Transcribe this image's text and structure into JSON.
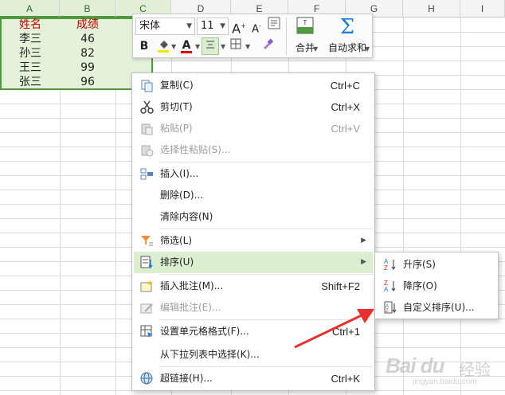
{
  "columns": [
    "A",
    "B",
    "C",
    "D",
    "E",
    "F",
    "G",
    "H",
    "I"
  ],
  "table": {
    "header": {
      "name": "姓名",
      "score": "成绩"
    },
    "rows": [
      {
        "name": "李三",
        "score": "46"
      },
      {
        "name": "孙三",
        "score": "82"
      },
      {
        "name": "王三",
        "score": "99"
      },
      {
        "name": "张三",
        "score": "96"
      }
    ]
  },
  "toolbar": {
    "font_name": "宋体",
    "font_size": "11",
    "grow_font_label": "A",
    "shrink_font_label": "A",
    "bold_label": "B",
    "font_color_label": "A",
    "merge_label": "合并",
    "autosum_label": "自动求和",
    "autosum_symbol": "Σ"
  },
  "context_menu": [
    {
      "label": "复制(C)",
      "shortcut": "Ctrl+C",
      "icon": "copy-icon",
      "disabled": false
    },
    {
      "label": "剪切(T)",
      "shortcut": "Ctrl+X",
      "icon": "cut-icon",
      "disabled": false
    },
    {
      "label": "粘贴(P)",
      "shortcut": "Ctrl+V",
      "icon": "paste-icon",
      "disabled": true
    },
    {
      "label": "选择性粘贴(S)...",
      "shortcut": "",
      "icon": "paste-special-icon",
      "disabled": true
    },
    {
      "label": "插入(I)...",
      "shortcut": "",
      "icon": "insert-icon",
      "disabled": false
    },
    {
      "label": "删除(D)...",
      "shortcut": "",
      "icon": "",
      "disabled": false
    },
    {
      "label": "清除内容(N)",
      "shortcut": "",
      "icon": "",
      "disabled": false
    },
    {
      "label": "筛选(L)",
      "shortcut": "",
      "icon": "filter-icon",
      "disabled": false,
      "submenu": true
    },
    {
      "label": "排序(U)",
      "shortcut": "",
      "icon": "sort-icon",
      "disabled": false,
      "submenu": true,
      "highlighted": true
    },
    {
      "label": "插入批注(M)...",
      "shortcut": "Shift+F2",
      "icon": "insert-comment-icon",
      "disabled": false
    },
    {
      "label": "编辑批注(E)...",
      "shortcut": "",
      "icon": "edit-comment-icon",
      "disabled": true
    },
    {
      "label": "设置单元格格式(F)...",
      "shortcut": "Ctrl+1",
      "icon": "format-cells-icon",
      "disabled": false
    },
    {
      "label": "从下拉列表中选择(K)...",
      "shortcut": "",
      "icon": "",
      "disabled": false
    },
    {
      "label": "超链接(H)...",
      "shortcut": "Ctrl+K",
      "icon": "hyperlink-icon",
      "disabled": false
    }
  ],
  "sort_submenu": [
    {
      "label": "升序(S)",
      "icon": "sort-ascending-icon"
    },
    {
      "label": "降序(O)",
      "icon": "sort-descending-icon"
    },
    {
      "label": "自定义排序(U)...",
      "icon": "custom-sort-icon"
    }
  ],
  "watermark": {
    "logo": "Bai du",
    "text": "经验",
    "url": "jingyan.baidu.com"
  },
  "colors": {
    "accent": "#4f9a3e",
    "selection": "#e4f2da",
    "highlight": "#dbeed0",
    "header_text": "#c00000",
    "arrow": "#e8312c"
  }
}
